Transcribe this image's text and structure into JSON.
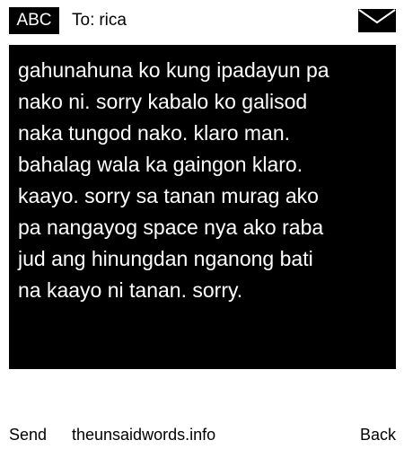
{
  "header": {
    "mode_label": "ABC",
    "to_prefix": "To:",
    "recipient": "rica",
    "envelope_icon": "envelope-icon"
  },
  "message": {
    "text": "gahunahuna ko kung ipadayun pa\nnako ni. sorry kabalo ko galisod\nnaka tungod nako. klaro man.\nbahalag wala ka gaingon klaro.\nkaayo. sorry sa tanan murag ako\npa nangayog space nya ako raba\njud ang hinungdan nganong bati\nna kaayo ni tanan. sorry."
  },
  "footer": {
    "send_label": "Send",
    "site_label": "theunsaidwords.info",
    "back_label": "Back"
  },
  "colors": {
    "background": "#ffffff",
    "panel": "#000000",
    "panel_text": "#ffffff",
    "text": "#000000"
  }
}
